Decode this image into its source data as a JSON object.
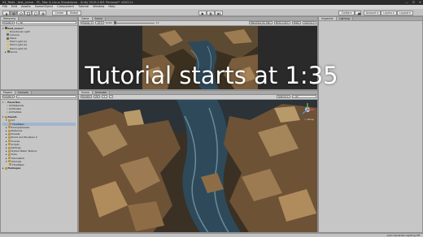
{
  "window": {
    "title": "04_Tests - test_scene - PC, Mac & Linux Standalone - Unity 2019.2.8f1 Personal* <DX11>",
    "controls": [
      "—",
      "☐",
      "✕"
    ]
  },
  "menu": [
    "File",
    "Edit",
    "Assets",
    "GameObject",
    "Component",
    "Tutorial",
    "Window",
    "Help"
  ],
  "toolbar": {
    "pivot": "Center",
    "space": "Global",
    "collab": "Collab ▾",
    "account": "Account ▾",
    "layers": "Layers ▾",
    "layout": "Layout ▾"
  },
  "hierarchy": {
    "tab": "Hierarchy",
    "create": "Create ▾",
    "search_placeholder": "All",
    "items": [
      {
        "label": "test_scene*",
        "bold": true,
        "icon": "scene-icon"
      },
      {
        "label": "Directional Light",
        "icon": "light-icon"
      },
      {
        "label": "Camera",
        "icon": "camera-icon"
      },
      {
        "label": "Plane",
        "icon": "gameobject-icon"
      },
      {
        "label": "Point Light (1)",
        "icon": "light-icon"
      },
      {
        "label": "Point Light (2)",
        "icon": "light-icon"
      },
      {
        "label": "Point Light (3)",
        "icon": "light-icon"
      },
      {
        "label": "Rocks",
        "icon": "gameobject-icon"
      }
    ]
  },
  "game_view": {
    "tabs": [
      "Game",
      "Scene"
    ],
    "display": "Display 1",
    "aspect": "16:9",
    "scale_label": "Scale",
    "scale_value": "1x",
    "options": [
      "Maximize On Play",
      "Mute Audio",
      "Stats",
      "Gizmos ▾"
    ]
  },
  "inspector": {
    "tabs": [
      "Inspector",
      "Lighting"
    ]
  },
  "project": {
    "tabs": [
      "Project",
      "Console"
    ],
    "create": "Create ▾",
    "breadcrumb": [
      "Assets",
      "Art",
      "FlowMaps"
    ],
    "favorites": {
      "label": "Favorites",
      "items": [
        "All Materials",
        "All Models",
        "All Prefabs"
      ]
    },
    "assets": {
      "label": "Assets",
      "items": [
        "Art",
        "FlowMaps",
        "ExampleAssets",
        "Materials",
        "Presets",
        "Rocks and Boulders 2",
        "Scenes",
        "Scripts",
        "Settings",
        "Stylize Water Texture",
        "Tools",
        "TutorialInfo",
        "Tutorials",
        "FlowMaps"
      ]
    },
    "packages": "Packages",
    "files": [
      "FlowMap_Current",
      "FlowMap_S_Curve",
      "FlowMap_WaterFlow",
      "FlowMap_WaterLevel"
    ]
  },
  "scene_view": {
    "tabs": [
      "Scene",
      "Animator"
    ],
    "shading": "Shaded",
    "mode": "2D",
    "gizmos": "Gizmos ▾",
    "search_placeholder": "All",
    "persp": "< Persp"
  },
  "overlay": {
    "text": "Tutorial starts at 1:35"
  },
  "status": {
    "text": "Auto Generate Lighting Off"
  },
  "colors": {
    "accent_play": "#4a8fe0",
    "panel": "#c6c6c6",
    "water": "#2e4a5a",
    "rock": "#8a6a45"
  }
}
